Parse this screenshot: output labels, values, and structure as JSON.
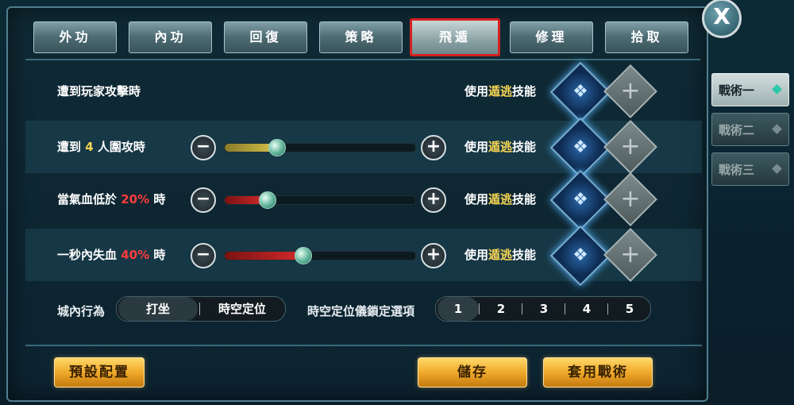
{
  "close_label": "X",
  "tabs": [
    {
      "label": "外功"
    },
    {
      "label": "內功"
    },
    {
      "label": "回復"
    },
    {
      "label": "策略"
    },
    {
      "label": "飛遁"
    },
    {
      "label": "修理"
    },
    {
      "label": "拾取"
    }
  ],
  "active_tab": "飛遁",
  "rows": [
    {
      "label": "遭到玩家攻擊時",
      "use_prefix": "使用",
      "use_skill": "遁逃",
      "use_suffix": "技能"
    },
    {
      "label_a": "遭到 ",
      "label_num": "4",
      "label_b": " 人圍攻時",
      "use_prefix": "使用",
      "use_skill": "遁逃",
      "use_suffix": "技能",
      "slider_fraction": 0.27
    },
    {
      "label_a": "當氣血低於 ",
      "label_num": "20%",
      "label_b": " 時",
      "use_prefix": "使用",
      "use_skill": "遁逃",
      "use_suffix": "技能",
      "slider_fraction": 0.22
    },
    {
      "label_a": "一秒內失血 ",
      "label_num": "40%",
      "label_b": " 時",
      "use_prefix": "使用",
      "use_skill": "遁逃",
      "use_suffix": "技能",
      "slider_fraction": 0.41
    }
  ],
  "minus_symbol": "−",
  "plus_symbol": "+",
  "city": {
    "label": "城內行為",
    "options": [
      "打坐",
      "時空定位"
    ],
    "selected": "打坐"
  },
  "lock": {
    "label": "時空定位儀鎖定選項",
    "options": [
      "1",
      "2",
      "3",
      "4",
      "5"
    ],
    "selected": "1"
  },
  "buttons": {
    "default_config": "預設配置",
    "save": "儲存",
    "apply": "套用戰術"
  },
  "side_tabs": [
    {
      "label": "戰術一",
      "active": true
    },
    {
      "label": "戰術二",
      "active": false
    },
    {
      "label": "戰術三",
      "active": false
    }
  ],
  "skill_icon": "blue-flame-escape-icon",
  "empty_slot_icon": "plus-slot-icon",
  "colors": {
    "highlight": "#f4d454",
    "danger": "#ff3c3c",
    "tab_selected_border": "#d42020",
    "gold_button": "#f0a92a"
  }
}
